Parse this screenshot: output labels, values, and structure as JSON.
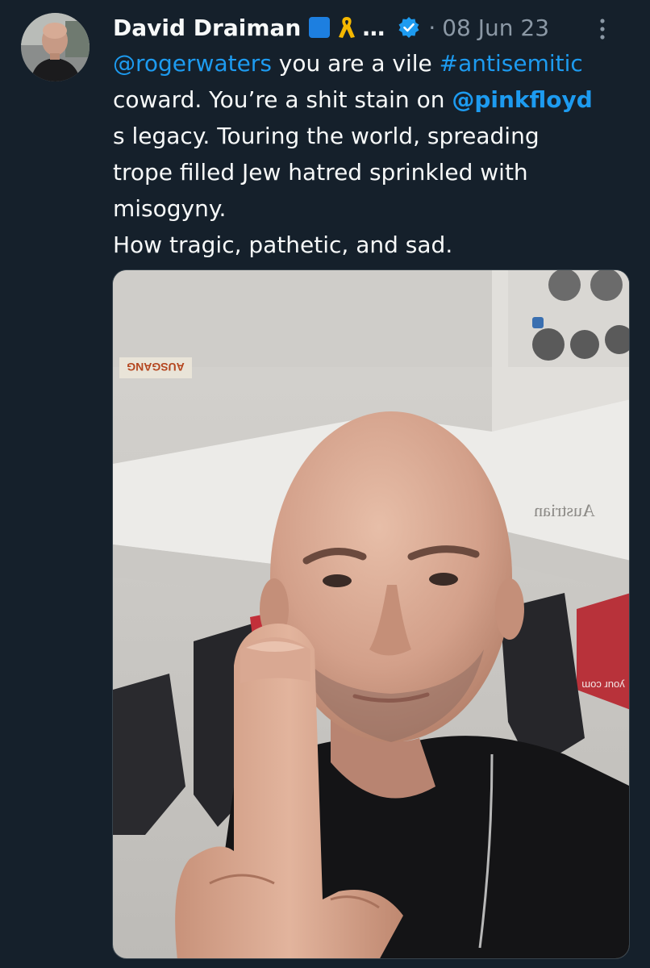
{
  "tweet": {
    "author": {
      "display_name": "David Draiman",
      "truncation": "…",
      "avatar_icon": "avatar",
      "flag_icon": "blue-square-emoji-icon",
      "ribbon_icon": "yellow-ribbon-emoji-icon",
      "verified_icon": "verified-badge-icon"
    },
    "separator": "·",
    "date": "08 Jun 23",
    "more_icon": "more-vertical-icon",
    "text": {
      "line1_mention": "@rogerwaters",
      "line1_mid": " you are a vile ",
      "line1_hashtag": "#antisemitic",
      "line2_pre": "coward. You’re a shit stain on ",
      "line2_mention": "@pinkfloyd",
      "line3": "s legacy. Touring the world, spreading",
      "line4": "trope filled Jew hatred sprinkled with",
      "line5": "misogyny.",
      "line6": "How tragic, pathetic, and sad."
    },
    "media": {
      "sign_text": "AUSGANG",
      "airline_text": "Austrian",
      "seat_text": "your com"
    }
  },
  "colors": {
    "background": "#15202b",
    "text": "#f7f9f9",
    "secondary": "#8b98a5",
    "accent": "#1d9bf0"
  }
}
